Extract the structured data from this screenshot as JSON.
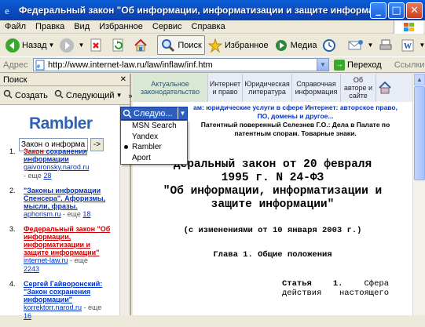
{
  "window": {
    "title": "Федеральный закон \"Об информации, информатизации и защите информации\" - Microso..."
  },
  "menubar": [
    "Файл",
    "Правка",
    "Вид",
    "Избранное",
    "Сервис",
    "Справка"
  ],
  "toolbar": {
    "back": "Назад",
    "search": "Поиск",
    "favorites": "Избранное",
    "media": "Медиа"
  },
  "address": {
    "label": "Адрес",
    "url": "http://www.internet-law.ru/law/inflaw/inf.htm",
    "go": "Переход",
    "links": "Ссылки"
  },
  "sidepanel": {
    "title": "Поиск",
    "create": "Создать",
    "next": "Следующий",
    "logo": "Rambler",
    "search_value": "Закон о информа",
    "go_symbol": "->",
    "results": [
      {
        "num": "1.",
        "title_pre": "",
        "title_hl": "Закон",
        "title_post": " сохранения информации",
        "url": "gaivoronsky.narod.ru",
        "more": "28"
      },
      {
        "num": "2.",
        "title_pre": "",
        "title_hl": "",
        "title_post": "\"Законы информации Спенсера\". Афоризмы, мысли, фразы.",
        "url": "aphorism.ru",
        "more": "18"
      },
      {
        "num": "3.",
        "title_pre": "Федеральный ",
        "title_hl": "закон",
        "title_post": " \"Об информации, информатизации и защите информации\"",
        "url": "internet-law.ru",
        "more": "2243"
      },
      {
        "num": "4.",
        "title_pre": "Сергей Гайворонский: ",
        "title_hl": "",
        "title_post": "\"Закон сохранения информации\"",
        "url": "korrektorr.narod.ru",
        "more": "16"
      }
    ],
    "more_label": "еще"
  },
  "engine": {
    "button": "Следую...",
    "options": [
      "MSN Search",
      "Yandex",
      "Rambler",
      "Aport"
    ],
    "selected": "Rambler"
  },
  "content": {
    "nav": [
      {
        "l1": "Актуальное",
        "l2": "законодательство"
      },
      {
        "l1": "Интернет",
        "l2": "и право"
      },
      {
        "l1": "Юридическая",
        "l2": "литература"
      },
      {
        "l1": "Справочная",
        "l2": "информация"
      },
      {
        "l1": "Об",
        "l2": "авторе и сайте"
      }
    ],
    "ad_line1": "ам: юридические услуги в сфере Интернет: авторское право,",
    "ad_line2": "ПО, домены и другое...",
    "ad_line3": "Патентный поверенный Селезнев Г.О.: Дела в Палате по",
    "ad_line4": "патентным спорам. Товарные знаки.",
    "heading_1": "деральный закон от 20 февраля",
    "heading_2": "1995 г. N 24-ФЗ",
    "heading_3": "\"Об информации, информатизации и",
    "heading_4": "защите информации\"",
    "amendments": "(с изменениями от 10 января 2003 г.)",
    "chapter": "Глава 1. Общие положения",
    "article_w1": "Статья",
    "article_w2": "1.",
    "article_w3": "Сфера",
    "article_w4": "действия",
    "article_w5": "настоящего"
  }
}
